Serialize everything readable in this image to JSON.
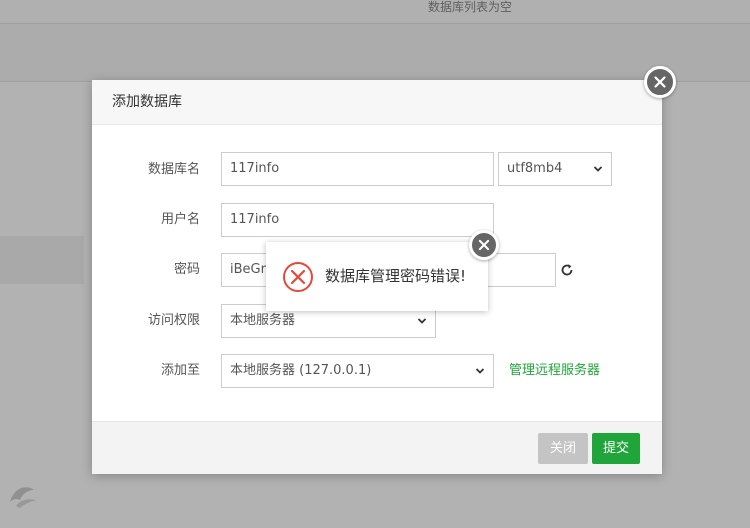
{
  "background": {
    "top_text": "数据库列表为空"
  },
  "dialog": {
    "title": "添加数据库",
    "fields": {
      "db_name": {
        "label": "数据库名",
        "value": "117info"
      },
      "charset": {
        "value": "utf8mb4"
      },
      "username": {
        "label": "用户名",
        "value": "117info"
      },
      "password": {
        "label": "密码",
        "value": "iBeGrl"
      },
      "access": {
        "label": "访问权限",
        "value": "本地服务器"
      },
      "add_to": {
        "label": "添加至",
        "value": "本地服务器 (127.0.0.1)"
      }
    },
    "manage_remote_link": "管理远程服务器",
    "buttons": {
      "close": "关闭",
      "submit": "提交"
    }
  },
  "toast": {
    "message": "数据库管理密码错误!"
  },
  "colors": {
    "accent_green": "#20a53a",
    "error_red": "#e8473a",
    "close_button": "#666666"
  },
  "icons": {
    "dialog_close": "close-icon",
    "toast_close": "close-icon",
    "error": "error-circle-icon",
    "refresh": "refresh-icon",
    "chevron": "chevron-down-icon"
  }
}
